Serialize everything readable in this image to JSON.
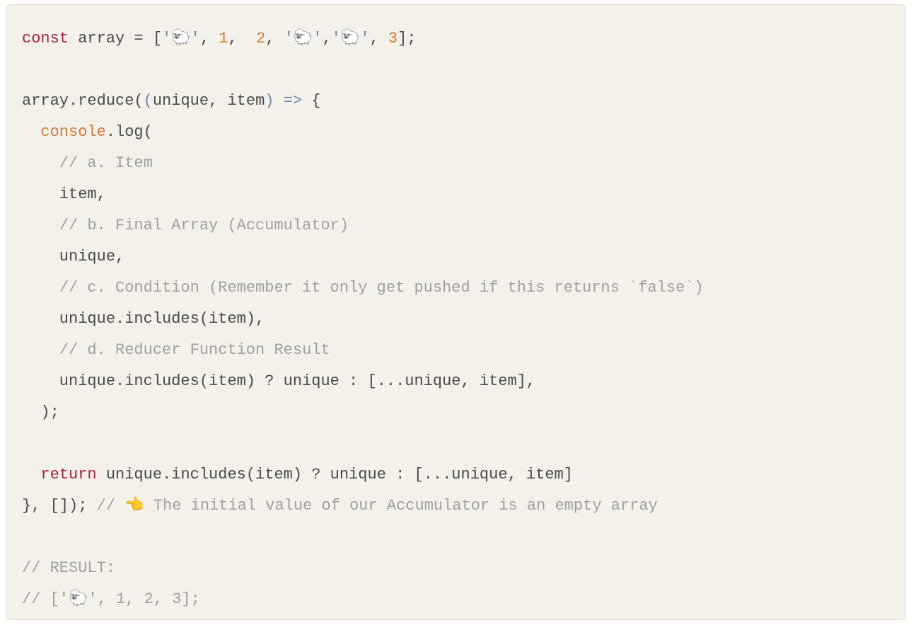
{
  "code": {
    "lines": [
      [
        {
          "cls": "tok-keyword",
          "t": "const"
        },
        {
          "cls": "tok-default",
          "t": " array "
        },
        {
          "cls": "tok-default",
          "t": "="
        },
        {
          "cls": "tok-default",
          "t": " ["
        },
        {
          "cls": "tok-string",
          "t": "'🐑'"
        },
        {
          "cls": "tok-default",
          "t": ", "
        },
        {
          "cls": "tok-number",
          "t": "1"
        },
        {
          "cls": "tok-default",
          "t": ",  "
        },
        {
          "cls": "tok-number",
          "t": "2"
        },
        {
          "cls": "tok-default",
          "t": ", "
        },
        {
          "cls": "tok-string",
          "t": "'🐑'"
        },
        {
          "cls": "tok-default",
          "t": ","
        },
        {
          "cls": "tok-string",
          "t": "'🐑'"
        },
        {
          "cls": "tok-default",
          "t": ", "
        },
        {
          "cls": "tok-number",
          "t": "3"
        },
        {
          "cls": "tok-default",
          "t": "];"
        }
      ],
      [],
      [
        {
          "cls": "tok-default",
          "t": "array.reduce("
        },
        {
          "cls": "tok-arrow",
          "t": "("
        },
        {
          "cls": "tok-default",
          "t": "unique, item"
        },
        {
          "cls": "tok-arrow",
          "t": ")"
        },
        {
          "cls": "tok-default",
          "t": " "
        },
        {
          "cls": "tok-arrow",
          "t": "=>"
        },
        {
          "cls": "tok-default",
          "t": " {"
        }
      ],
      [
        {
          "cls": "tok-default",
          "t": "  "
        },
        {
          "cls": "tok-builtin",
          "t": "console"
        },
        {
          "cls": "tok-default",
          "t": ".log("
        }
      ],
      [
        {
          "cls": "tok-default",
          "t": "    "
        },
        {
          "cls": "tok-comment",
          "t": "// a. Item"
        }
      ],
      [
        {
          "cls": "tok-default",
          "t": "    item,"
        }
      ],
      [
        {
          "cls": "tok-default",
          "t": "    "
        },
        {
          "cls": "tok-comment",
          "t": "// b. Final Array (Accumulator)"
        }
      ],
      [
        {
          "cls": "tok-default",
          "t": "    unique,"
        }
      ],
      [
        {
          "cls": "tok-default",
          "t": "    "
        },
        {
          "cls": "tok-comment",
          "t": "// c. Condition (Remember it only get pushed if this returns `false`)"
        }
      ],
      [
        {
          "cls": "tok-default",
          "t": "    unique.includes(item),"
        }
      ],
      [
        {
          "cls": "tok-default",
          "t": "    "
        },
        {
          "cls": "tok-comment",
          "t": "// d. Reducer Function Result"
        }
      ],
      [
        {
          "cls": "tok-default",
          "t": "    unique.includes(item) ? unique : [...unique, item],"
        }
      ],
      [
        {
          "cls": "tok-default",
          "t": "  );"
        }
      ],
      [],
      [
        {
          "cls": "tok-default",
          "t": "  "
        },
        {
          "cls": "tok-keyword",
          "t": "return"
        },
        {
          "cls": "tok-default",
          "t": " unique.includes(item) ? unique : [...unique, item]"
        }
      ],
      [
        {
          "cls": "tok-default",
          "t": "}, []); "
        },
        {
          "cls": "tok-comment",
          "t": "// 👈 The initial value of our Accumulator is an empty array"
        }
      ],
      [],
      [
        {
          "cls": "tok-comment",
          "t": "// RESULT:"
        }
      ],
      [
        {
          "cls": "tok-comment",
          "t": "// ['🐑', 1, 2, 3];"
        }
      ]
    ]
  }
}
